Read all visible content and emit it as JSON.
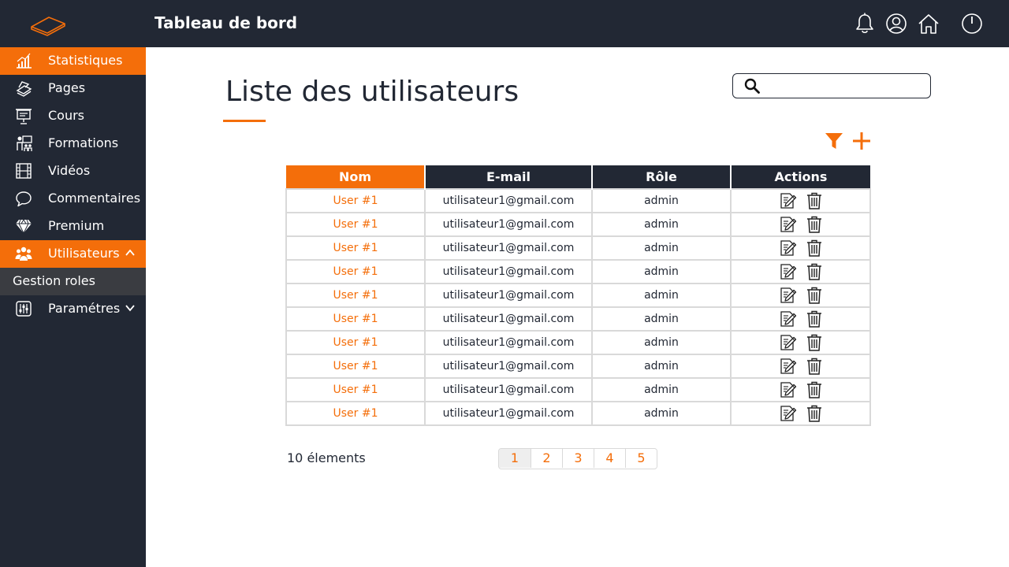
{
  "topbar": {
    "title": "Tableau de bord"
  },
  "sidebar": {
    "items": [
      {
        "label": "Statistiques",
        "icon": "chart-icon",
        "active": true
      },
      {
        "label": "Pages",
        "icon": "pages-icon"
      },
      {
        "label": "Cours",
        "icon": "presentation-icon"
      },
      {
        "label": "Formations",
        "icon": "training-icon"
      },
      {
        "label": "Vidéos",
        "icon": "film-icon"
      },
      {
        "label": "Commentaires",
        "icon": "comment-icon"
      },
      {
        "label": "Premium",
        "icon": "diamond-icon"
      },
      {
        "label": "Utilisateurs",
        "icon": "users-icon",
        "active": true,
        "expanded": true
      },
      {
        "label": "Gestion roles",
        "submenu": true
      },
      {
        "label": "Paramétres",
        "icon": "sliders-icon"
      }
    ]
  },
  "main": {
    "title": "Liste des utilisateurs"
  },
  "table": {
    "columns": [
      "Nom",
      "E-mail",
      "Rôle",
      "Actions"
    ],
    "rows": [
      {
        "name": "User #1",
        "email": "utilisateur1@gmail.com",
        "role": "admin"
      },
      {
        "name": "User #1",
        "email": "utilisateur1@gmail.com",
        "role": "admin"
      },
      {
        "name": "User #1",
        "email": "utilisateur1@gmail.com",
        "role": "admin"
      },
      {
        "name": "User #1",
        "email": "utilisateur1@gmail.com",
        "role": "admin"
      },
      {
        "name": "User #1",
        "email": "utilisateur1@gmail.com",
        "role": "admin"
      },
      {
        "name": "User #1",
        "email": "utilisateur1@gmail.com",
        "role": "admin"
      },
      {
        "name": "User #1",
        "email": "utilisateur1@gmail.com",
        "role": "admin"
      },
      {
        "name": "User #1",
        "email": "utilisateur1@gmail.com",
        "role": "admin"
      },
      {
        "name": "User #1",
        "email": "utilisateur1@gmail.com",
        "role": "admin"
      },
      {
        "name": "User #1",
        "email": "utilisateur1@gmail.com",
        "role": "admin"
      }
    ]
  },
  "footer": {
    "count": "10 élements",
    "pages": [
      "1",
      "2",
      "3",
      "4",
      "5"
    ],
    "current_page": "1"
  },
  "colors": {
    "accent": "#f46e0a",
    "dark": "#222834",
    "submenu": "#3a3c41",
    "border": "#d9d9d9"
  }
}
